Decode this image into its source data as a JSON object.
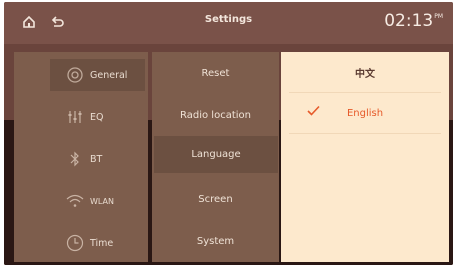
{
  "topbar": {
    "title": "Settings",
    "time": "02:13",
    "time_suffix": "PM",
    "home_icon": "home-icon",
    "back_icon": "back-icon"
  },
  "sidebar": {
    "items": [
      {
        "label": "General",
        "icon": "gear-icon",
        "active": true
      },
      {
        "label": "EQ",
        "icon": "equalizer-icon",
        "active": false
      },
      {
        "label": "BT",
        "icon": "bluetooth-icon",
        "active": false
      },
      {
        "label": "WLAN",
        "icon": "wifi-icon",
        "active": false
      },
      {
        "label": "Time",
        "icon": "clock-icon",
        "active": false
      }
    ]
  },
  "submenu": {
    "items": [
      {
        "label": "Reset"
      },
      {
        "label": "Radio location"
      },
      {
        "label": "Language",
        "active": true
      },
      {
        "label": "Screen"
      },
      {
        "label": "System"
      }
    ]
  },
  "language_options": {
    "items": [
      {
        "label": "中文",
        "selected": false
      },
      {
        "label": "English",
        "selected": true
      }
    ]
  },
  "colors": {
    "accent": "#e65a2a",
    "panel": "#fde9cd",
    "topbar": "#7a5249",
    "menu_bg": "#7d5d4c",
    "menu_active": "#6c5041"
  }
}
